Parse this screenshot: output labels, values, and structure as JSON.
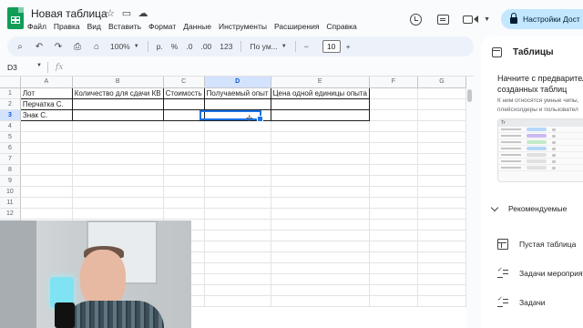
{
  "app": {
    "title": "Новая таблица"
  },
  "menu": [
    "Файл",
    "Правка",
    "Вид",
    "Вставить",
    "Формат",
    "Данные",
    "Инструменты",
    "Расширения",
    "Справка"
  ],
  "share": {
    "label": "Настройки Дост"
  },
  "toolbar": {
    "zoom": "100%",
    "currency": "р.",
    "percent": "%",
    "dec_decrease": ".0",
    "dec_increase": ".00",
    "number_format": "123",
    "font": "По ум...",
    "minus": "−",
    "font_size": "10",
    "plus": "+"
  },
  "formula_bar": {
    "cell_ref": "D3",
    "fx": "fx"
  },
  "sheet": {
    "columns": [
      "A",
      "B",
      "C",
      "D",
      "E",
      "F",
      "G"
    ],
    "rows": [
      [
        "Лот",
        "Количество для сдачи КВ",
        "Стоимость",
        "Получаемый опыт",
        "Цена одной единицы опыта",
        "",
        ""
      ],
      [
        "Перчатка С.",
        "",
        "",
        "",
        "",
        "",
        ""
      ],
      [
        "Знак С.",
        "",
        "",
        "",
        "",
        "",
        ""
      ],
      [
        "",
        "",
        "",
        "",
        "",
        "",
        ""
      ],
      [
        "",
        "",
        "",
        "",
        "",
        "",
        ""
      ],
      [
        "",
        "",
        "",
        "",
        "",
        "",
        ""
      ],
      [
        "",
        "",
        "",
        "",
        "",
        "",
        ""
      ],
      [
        "",
        "",
        "",
        "",
        "",
        "",
        ""
      ],
      [
        "",
        "",
        "",
        "",
        "",
        "",
        ""
      ],
      [
        "",
        "",
        "",
        "",
        "",
        "",
        ""
      ],
      [
        "",
        "",
        "",
        "",
        "",
        "",
        ""
      ],
      [
        "",
        "",
        "",
        "",
        "",
        "",
        ""
      ],
      [
        "",
        "",
        "",
        "",
        "",
        "",
        ""
      ],
      [
        "",
        "",
        "",
        "",
        "",
        "",
        ""
      ],
      [
        "",
        "",
        "",
        "",
        "",
        "",
        ""
      ],
      [
        "",
        "",
        "",
        "",
        "",
        "",
        ""
      ],
      [
        "",
        "",
        "",
        "",
        "",
        "",
        ""
      ],
      [
        "",
        "",
        "",
        "",
        "",
        "",
        ""
      ],
      [
        "",
        "",
        "",
        "",
        "",
        "",
        ""
      ],
      [
        "",
        "",
        "",
        "",
        "",
        "",
        ""
      ]
    ],
    "active_cell": "D3"
  },
  "panel": {
    "title": "Таблицы",
    "subtitle_line1": "Начните с предварител",
    "subtitle_line2": "созданных таблиц",
    "desc_line1": "К ним относятся умные чипы,",
    "desc_line2": "плейсхолдеры и пользовател",
    "preview_header": "Тг",
    "recommended": "Рекомендуемые",
    "items": [
      {
        "label": "Пустая таблица",
        "icon": "table-icon"
      },
      {
        "label": "Задачи мероприяти",
        "icon": "checklist-icon"
      },
      {
        "label": "Задачи",
        "icon": "checklist-icon"
      }
    ]
  },
  "colors": {
    "accent": "#1a73e8",
    "share_bg": "#c2e7ff",
    "toolbar_bg": "#edf2fa",
    "selected_header": "#d3e3fd"
  }
}
